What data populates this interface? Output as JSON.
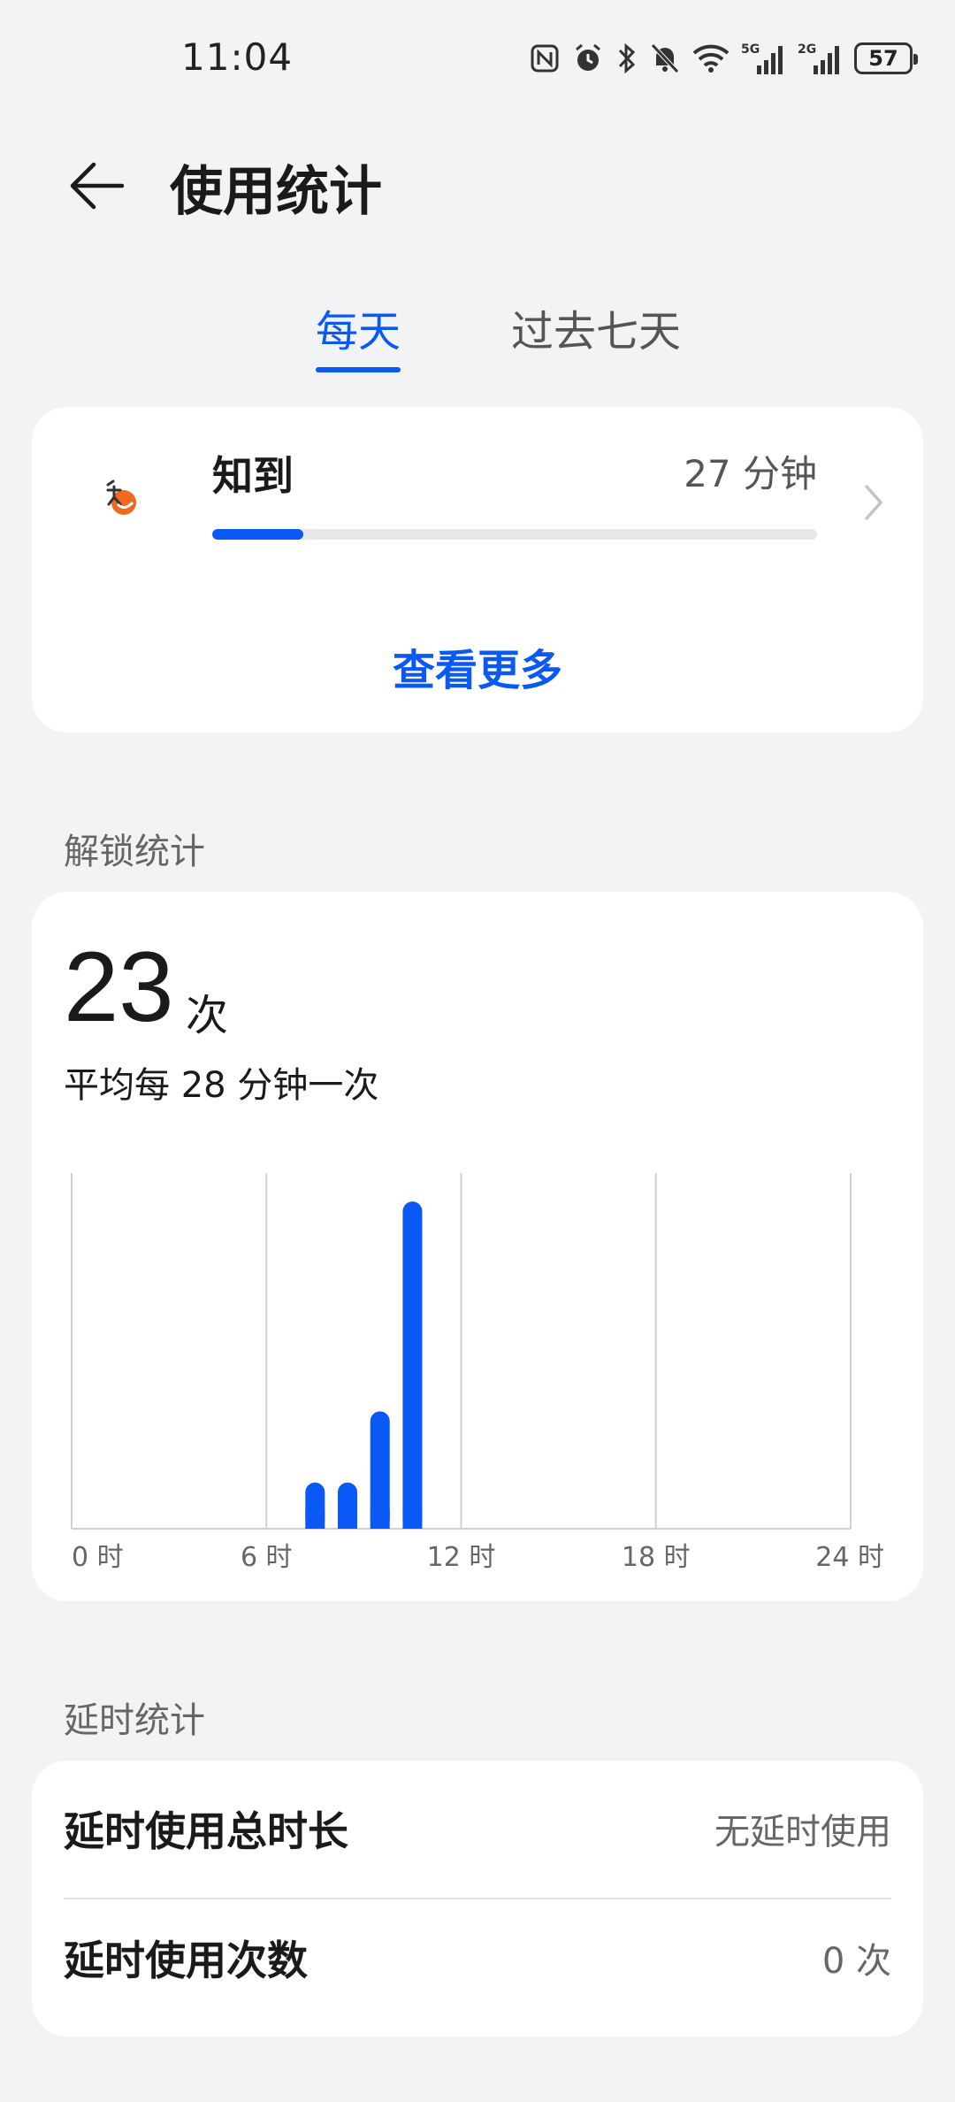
{
  "status_bar": {
    "time": "11:04",
    "battery": "57",
    "icons": [
      "nfc-icon",
      "alarm-icon",
      "bluetooth-icon",
      "mute-icon",
      "wifi-icon",
      "signal-5g-icon",
      "signal-2g-icon",
      "battery-icon"
    ],
    "signal_labels": [
      "5G",
      "2G"
    ]
  },
  "header": {
    "title": "使用统计"
  },
  "tabs": [
    {
      "label": "每天",
      "active": true
    },
    {
      "label": "过去七天",
      "active": false
    }
  ],
  "app_usage": {
    "name": "知到",
    "duration": "27 分钟",
    "progress": 0.15,
    "see_more": "查看更多"
  },
  "unlock": {
    "section_label": "解锁统计",
    "count": "23",
    "unit": "次",
    "average": "平均每 28 分钟一次"
  },
  "chart_data": {
    "type": "bar",
    "x_ticks": [
      "0 时",
      "6 时",
      "12 时",
      "18 时",
      "24 时"
    ],
    "xlim": [
      0,
      24
    ],
    "ylim": [
      0,
      10
    ],
    "bars": [
      {
        "hour": 7.5,
        "value": 1.3
      },
      {
        "hour": 8.5,
        "value": 1.3
      },
      {
        "hour": 9.5,
        "value": 3.3
      },
      {
        "hour": 10.5,
        "value": 9.2
      }
    ],
    "grid": true,
    "color": "#0a59f7"
  },
  "delay": {
    "section_label": "延时统计",
    "rows": [
      {
        "label": "延时使用总时长",
        "value": "无延时使用"
      },
      {
        "label": "延时使用次数",
        "value": "0 次"
      }
    ]
  },
  "colors": {
    "accent": "#0a59f7",
    "background": "#f1f3f5",
    "card": "#ffffff"
  }
}
